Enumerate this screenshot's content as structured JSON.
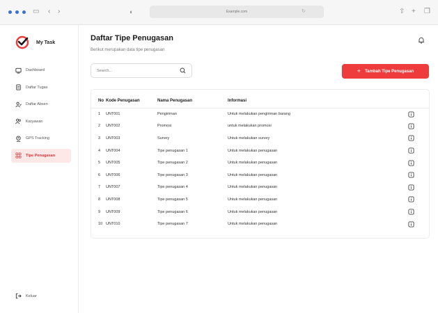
{
  "browser": {
    "url": "Example.com"
  },
  "brand": {
    "name": "My Task"
  },
  "sidebar": {
    "items": [
      {
        "label": "Dashboard",
        "active": false
      },
      {
        "label": "Daftar Tugas",
        "active": false
      },
      {
        "label": "Daftar Absen",
        "active": false
      },
      {
        "label": "Karyawan",
        "active": false
      },
      {
        "label": "GPS Tracking",
        "active": false
      },
      {
        "label": "Tipe Penugasan",
        "active": true
      }
    ],
    "logout": "Keluar"
  },
  "header": {
    "title": "Daftar Tipe Penugasan",
    "subtitle": "Berikut merupakan data tipe penugasan"
  },
  "search": {
    "placeholder": "Search..."
  },
  "add_button": {
    "label": "Tambah Tipe Penugasan"
  },
  "colors": {
    "accent": "#ee3b3b",
    "active_bg": "#fde8e8",
    "browser_dots": "#3b6fd8"
  },
  "table": {
    "columns": [
      "No",
      "Kode Penugasan",
      "Nama Penugasan",
      "Informasi"
    ],
    "rows": [
      {
        "no": "1",
        "kode": "UNT001",
        "nama": "Pengiriman",
        "info": "Untuk melakukan pengiriman barang"
      },
      {
        "no": "2",
        "kode": "UNT002",
        "nama": "Promosi",
        "info": "untuk melakukan promosi"
      },
      {
        "no": "3",
        "kode": "UNT003",
        "nama": "Survey",
        "info": "Untuk melakukan survey"
      },
      {
        "no": "4",
        "kode": "UNT004",
        "nama": "Tipe penugasan 1",
        "info": "Untuk melakukan penugasan"
      },
      {
        "no": "5",
        "kode": "UNT005",
        "nama": "Tipe penugasan 2",
        "info": "Untuk melakukan penugasan"
      },
      {
        "no": "6",
        "kode": "UNT006",
        "nama": "Tipe penugasan 3",
        "info": "Untuk melakukan penugasan"
      },
      {
        "no": "7",
        "kode": "UNT007",
        "nama": "Tipe penugasan 4",
        "info": "Untuk melakukan penugasan"
      },
      {
        "no": "8",
        "kode": "UNT008",
        "nama": "Tipe penugasan 5",
        "info": "Untuk melakukan penugasan"
      },
      {
        "no": "9",
        "kode": "UNT009",
        "nama": "Tipe penugasan 6",
        "info": "Untuk melakukan penugasan"
      },
      {
        "no": "10",
        "kode": "UNT010",
        "nama": "Tipe penugasan 7",
        "info": "Untuk melakukan penugasan"
      }
    ]
  }
}
